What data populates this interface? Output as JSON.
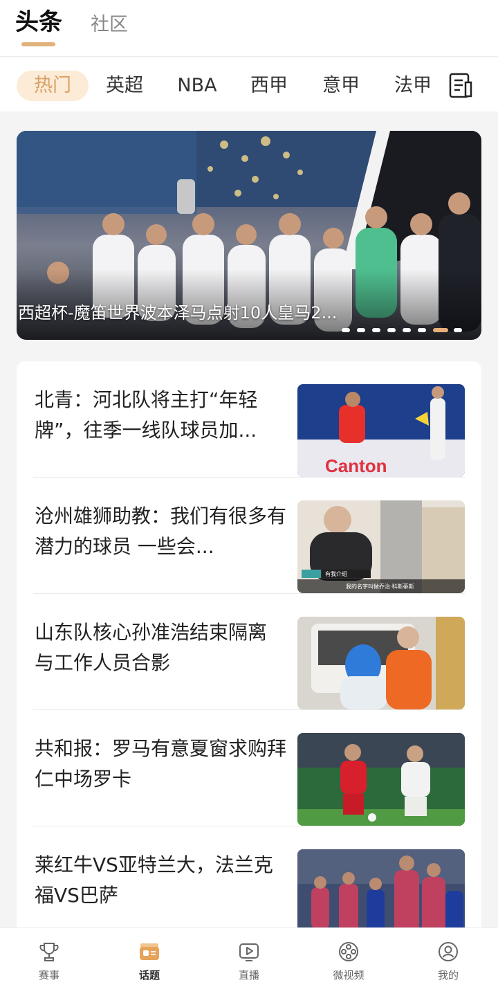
{
  "top_tabs": [
    {
      "label": "头条",
      "active": true
    },
    {
      "label": "社区",
      "active": false
    }
  ],
  "categories": [
    {
      "label": "热门",
      "active": true
    },
    {
      "label": "英超",
      "active": false
    },
    {
      "label": "NBA",
      "active": false
    },
    {
      "label": "西甲",
      "active": false
    },
    {
      "label": "意甲",
      "active": false
    },
    {
      "label": "法甲",
      "active": false
    }
  ],
  "category_edit_icon": "list-edit-icon",
  "banner": {
    "caption": "西超杯-魔笛世界波本泽马点射10人皇马2...",
    "slide_count": 8,
    "active_slide": 7
  },
  "news": [
    {
      "title": "北青：河北队将主打“年轻牌”，往季一线队球员加...",
      "thumb": "football-red-vs-white"
    },
    {
      "title": "沧州雄狮助教：我们有很多有潜力的球员 一些会...",
      "thumb": "coach-interview",
      "thumb_badge": "有我介绍",
      "thumb_subtitle": "我的名字叫做乔治·科斯蒂斯"
    },
    {
      "title": "山东队核心孙准浩结束隔离 与工作人员合影",
      "thumb": "player-with-medical-staff"
    },
    {
      "title": "共和报：罗马有意夏窗求购拜仁中场罗卡",
      "thumb": "bayern-match"
    },
    {
      "title": "莱红牛VS亚特兰大，法兰克福VS巴萨",
      "thumb": "barcelona-team"
    }
  ],
  "bottom_nav": [
    {
      "label": "赛事",
      "icon": "trophy-icon",
      "active": false
    },
    {
      "label": "话题",
      "icon": "topic-card-icon",
      "active": true
    },
    {
      "label": "直播",
      "icon": "play-icon",
      "active": false
    },
    {
      "label": "微视频",
      "icon": "film-reel-icon",
      "active": false
    },
    {
      "label": "我的",
      "icon": "profile-icon",
      "active": false
    }
  ],
  "colors": {
    "accent": "#e2b27c",
    "accent_bg": "#fcebd6",
    "accent_text": "#d9a066"
  }
}
